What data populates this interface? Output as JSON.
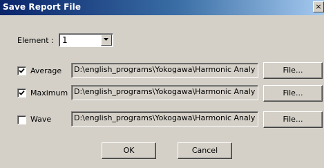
{
  "window": {
    "title": "Save Report File",
    "close_glyph": "×"
  },
  "element": {
    "label": "Element :",
    "value": "1"
  },
  "rows": [
    {
      "label": "Average",
      "checked": true,
      "path": "D:\\english_programs\\Yokogawa\\Harmonic Analy",
      "button": "File..."
    },
    {
      "label": "Maximum",
      "checked": true,
      "path": "D:\\english_programs\\Yokogawa\\Harmonic Analy",
      "button": "File..."
    },
    {
      "label": "Wave",
      "checked": false,
      "path": "D:\\english_programs\\Yokogawa\\Harmonic Analy",
      "button": "File..."
    }
  ],
  "buttons": {
    "ok": "OK",
    "cancel": "Cancel"
  },
  "colors": {
    "title_gradient_start": "#0a246a",
    "title_gradient_end": "#a6caf0",
    "face": "#d4d0c8"
  },
  "icons": {
    "close": "close-icon",
    "dropdown": "chevron-down-icon",
    "check": "check-icon"
  }
}
